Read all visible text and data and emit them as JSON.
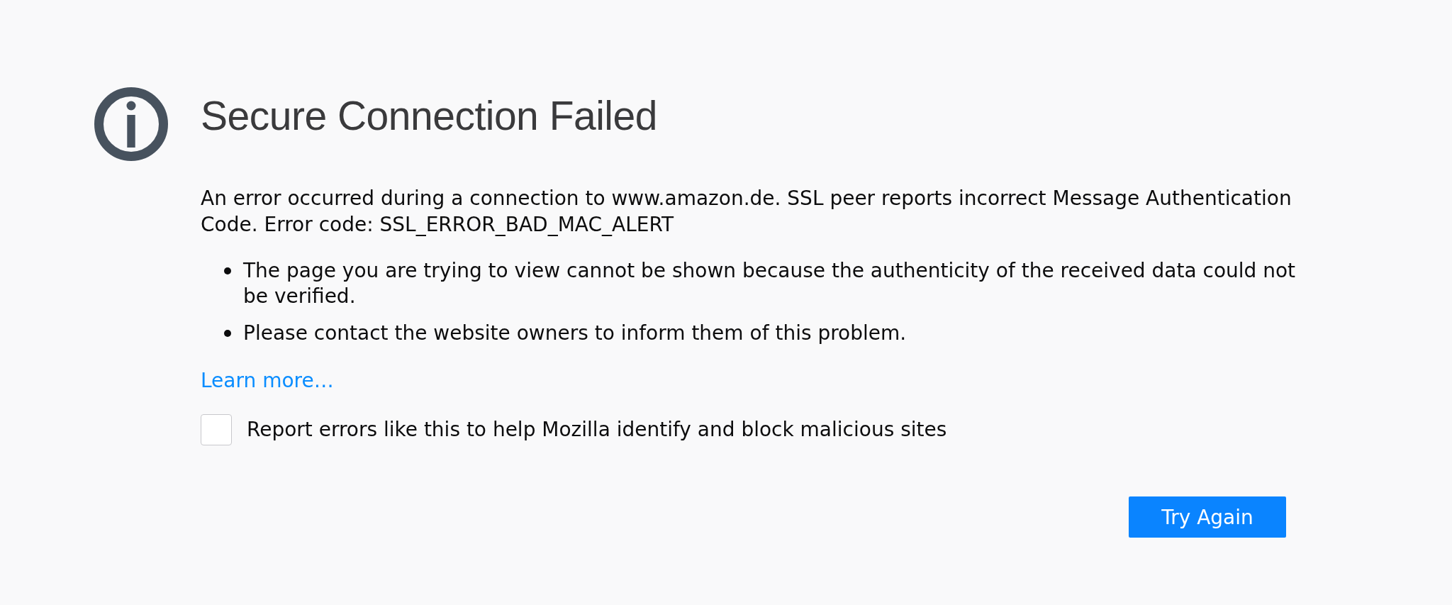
{
  "error_page": {
    "title": "Secure Connection Failed",
    "description": "An error occurred during a connection to www.amazon.de. SSL peer reports incorrect Message Authentication Code. Error code: SSL_ERROR_BAD_MAC_ALERT",
    "bullets": [
      "The page you are trying to view cannot be shown because the authenticity of the received data could not be verified.",
      "Please contact the website owners to inform them of this problem."
    ],
    "learn_more_link": "Learn more…",
    "report_option": {
      "label": "Report errors like this to help Mozilla identify and block malicious sites",
      "checked": false
    },
    "try_again_button": "Try Again"
  }
}
